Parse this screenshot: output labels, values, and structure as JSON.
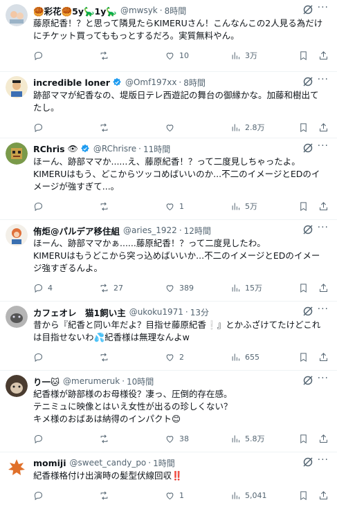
{
  "tweets": [
    {
      "name": "🥮彩花🥮5y🦕1y🦕",
      "handle": "@mwsyk",
      "time": "8時間",
      "verified": false,
      "text": "藤原紀香！？と思って隣見たらKIMERUさん！こんなんこの2人見る為だけにチケット買ってももっとするだろ。実質無料やん。",
      "replies": "",
      "retweets": "",
      "likes": "10",
      "views": "3万",
      "avatar_color": "#c9d6e3"
    },
    {
      "name": "incredible loner",
      "handle": "@Omf197xx",
      "time": "8時間",
      "verified": true,
      "text": "跡部ママが紀香なの、堤版日テレ西遊記の舞台の御縁かな。加藤和樹出てたし。",
      "replies": "",
      "retweets": "",
      "likes": "",
      "views": "2.8万",
      "avatar_color": "#f2e6b8"
    },
    {
      "name": "RChris",
      "handle": "@RChrisre",
      "time": "11時間",
      "verified": true,
      "emoji": "👁",
      "text": "ほーん、跡部ママか......え、藤原紀香！？って二度見しちゃったよ。\nKIMERUはもう、どこからツッコめばいいのか...不二のイメージとEDのイメージが強すぎて...。",
      "replies": "",
      "retweets": "",
      "likes": "1",
      "views": "5万",
      "avatar_color": "#6b8e3a"
    },
    {
      "name": "侑炬@パルデア移住組",
      "handle": "@aries_1922",
      "time": "12時間",
      "verified": false,
      "text": "ほーん、跡部ママかぁ......藤原紀香！？って二度見したわ。\nKIMERUはもうどこから突っ込めばいいか...不二のイメージとEDのイメージ強すぎるんよ。",
      "replies": "4",
      "retweets": "27",
      "likes": "389",
      "views": "15万",
      "avatar_color": "#e07a3a"
    },
    {
      "name": "カフェオレ　猫1飼い主",
      "handle": "@ukoku1971",
      "time": "13分",
      "verified": false,
      "text": "昔から『紀香と同い年だよ？目指せ藤原紀香❕』とかふざけてたけどこれは目指せないわ💦紀香様は無理なんよw",
      "replies": "",
      "retweets": "",
      "likes": "2",
      "views": "655",
      "avatar_color": "#8a8a8a"
    },
    {
      "name": "り一🐱",
      "handle": "@merumeruk",
      "time": "10時間",
      "verified": false,
      "text": "紀香様が跡部様のお母様役？凄っ、圧倒的存在感。\nテニミュに映像とはいえ女性が出るの珍しくない？\nキメ様のおばあは納得のインパクト😊",
      "replies": "",
      "retweets": "",
      "likes": "38",
      "views": "5.8万",
      "avatar_color": "#5a4a3a"
    },
    {
      "name": "momiji",
      "handle": "@sweet_candy_po",
      "time": "1時間",
      "verified": false,
      "text": "紀香様格付け出演時の髪型伏線回収‼️",
      "replies": "",
      "retweets": "",
      "likes": "1",
      "views": "5,041",
      "avatar_color": "#ffffff"
    }
  ],
  "icons": {
    "reply": "reply-icon",
    "retweet": "retweet-icon",
    "like": "like-icon",
    "views": "views-icon",
    "bookmark": "bookmark-icon",
    "share": "share-icon",
    "grok": "grok-icon",
    "more": "more-icon",
    "verified": "verified-badge-icon"
  },
  "colors": {
    "verified": "#1d9bf0",
    "secondary_text": "#536471",
    "divider": "#eff3f4"
  },
  "ui": {
    "dot": "·",
    "more": "···"
  }
}
